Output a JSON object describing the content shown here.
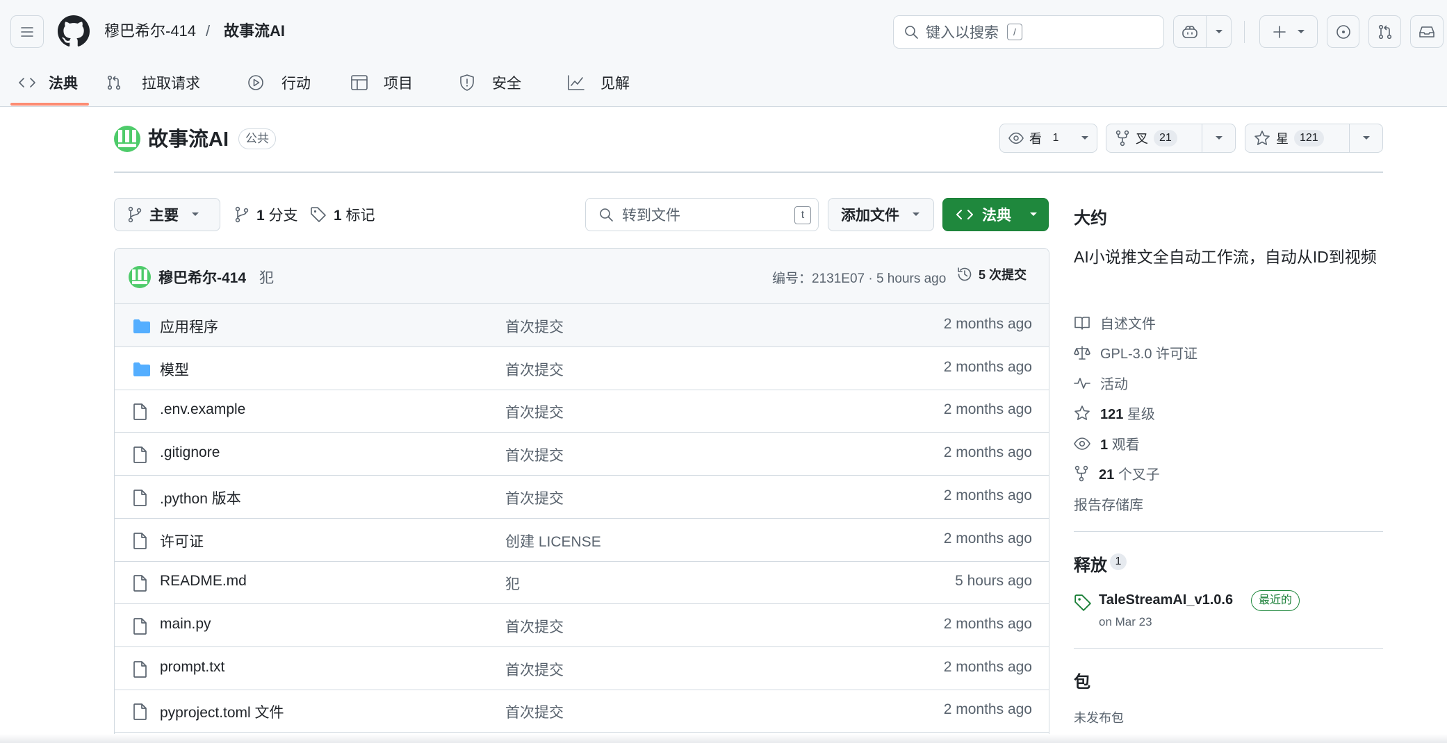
{
  "header": {
    "owner": "穆巴希尔-414",
    "separator": "/",
    "repo": "故事流AI",
    "search_placeholder": "键入以搜索",
    "search_shortcut": "/"
  },
  "tabs": [
    {
      "label": "法典",
      "icon": "code-icon",
      "active": true
    },
    {
      "label": "拉取请求",
      "icon": "pull-request-icon"
    },
    {
      "label": "行动",
      "icon": "play-icon"
    },
    {
      "label": "项目",
      "icon": "table-icon"
    },
    {
      "label": "安全",
      "icon": "shield-icon"
    },
    {
      "label": "见解",
      "icon": "graph-icon"
    }
  ],
  "repo": {
    "name": "故事流AI",
    "visibility": "公共",
    "watch_label": "看",
    "watch_count": "1",
    "fork_label": "叉",
    "fork_count": "21",
    "star_label": "星",
    "star_count": "121"
  },
  "toolbar": {
    "branch": "主要",
    "branches_count": "1",
    "branches_label": "分支",
    "tags_count": "1",
    "tags_label": "标记",
    "goto_placeholder": "转到文件",
    "goto_shortcut": "t",
    "add_file": "添加文件",
    "code": "法典"
  },
  "commit": {
    "author": "穆巴希尔-414",
    "message": "犯",
    "meta": "编号：2131E07 · 5 hours ago",
    "count_label": "5 次提交"
  },
  "files": [
    {
      "name": "应用程序",
      "type": "folder",
      "message": "首次提交",
      "age": "2 months ago"
    },
    {
      "name": "模型",
      "type": "folder",
      "message": "首次提交",
      "age": "2 months ago"
    },
    {
      "name": ".env.example",
      "type": "file",
      "message": "首次提交",
      "age": "2 months ago"
    },
    {
      "name": ".gitignore",
      "type": "file",
      "message": "首次提交",
      "age": "2 months ago"
    },
    {
      "name": ".python 版本",
      "type": "file",
      "message": "首次提交",
      "age": "2 months ago"
    },
    {
      "name": "许可证",
      "type": "file",
      "message": "创建 LICENSE",
      "age": "2 months ago"
    },
    {
      "name": "README.md",
      "type": "file",
      "message": "犯",
      "age": "5 hours ago"
    },
    {
      "name": "main.py",
      "type": "file",
      "message": "首次提交",
      "age": "2 months ago"
    },
    {
      "name": "prompt.txt",
      "type": "file",
      "message": "首次提交",
      "age": "2 months ago"
    },
    {
      "name": "pyproject.toml 文件",
      "type": "file",
      "message": "首次提交",
      "age": "2 months ago"
    }
  ],
  "about": {
    "title": "大约",
    "description": "AI小说推文全自动工作流，自动从ID到视频",
    "readme": "自述文件",
    "license": "GPL-3.0 许可证",
    "activity": "活动",
    "stars_count": "121",
    "stars_label": "星级",
    "watching_count": "1",
    "watching_label": "观看",
    "forks_count": "21",
    "forks_label": "个叉子",
    "report": "报告存储库"
  },
  "releases": {
    "title": "释放",
    "count": "1",
    "name": "TaleStreamAI_v1.0.6",
    "badge": "最近的",
    "date": "on Mar 23"
  },
  "packages": {
    "title": "包",
    "empty": "未发布包"
  },
  "colors": {
    "accent_green": "#1f883d",
    "tab_underline": "#fd8c73",
    "folder_blue": "#54aeff"
  }
}
